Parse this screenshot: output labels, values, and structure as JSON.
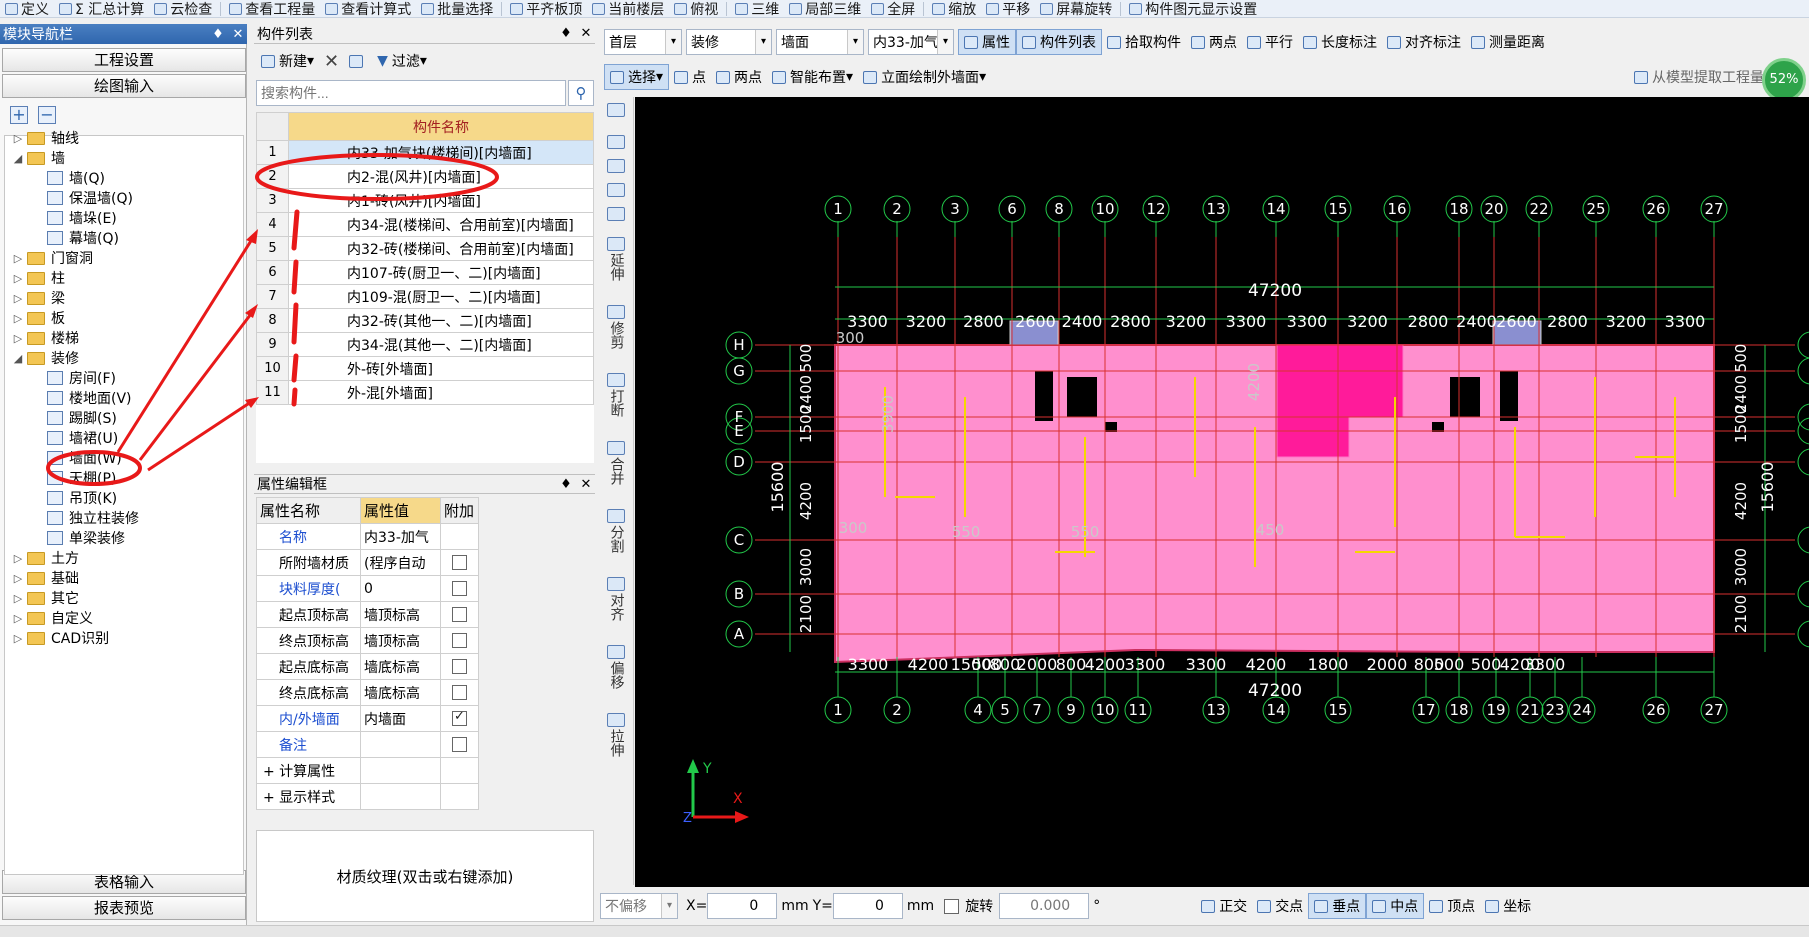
{
  "top_toolbar": {
    "items": [
      "定义",
      "Σ 汇总计算",
      "云检查",
      "查看工程量",
      "查看计算式",
      "批量选择",
      "平齐板顶",
      "当前楼层",
      "俯视",
      "三维",
      "局部三维",
      "全屏",
      "缩放",
      "平移",
      "屏幕旋转",
      "构件图元显示设置"
    ]
  },
  "nav": {
    "title": "模块导航栏",
    "pin": "♦",
    "close": "✕",
    "btn_project": "工程设置",
    "btn_draw": "绘图输入",
    "btn_table": "表格输入",
    "btn_report": "报表预览",
    "tree": [
      {
        "label": "轴线",
        "type": "folder",
        "exp": "▷"
      },
      {
        "label": "墙",
        "type": "folder",
        "exp": "◢"
      },
      {
        "label": "墙(Q)",
        "type": "leaf"
      },
      {
        "label": "保温墙(Q)",
        "type": "leaf"
      },
      {
        "label": "墙垛(E)",
        "type": "leaf"
      },
      {
        "label": "幕墙(Q)",
        "type": "leaf"
      },
      {
        "label": "门窗洞",
        "type": "folder",
        "exp": "▷"
      },
      {
        "label": "柱",
        "type": "folder",
        "exp": "▷"
      },
      {
        "label": "梁",
        "type": "folder",
        "exp": "▷"
      },
      {
        "label": "板",
        "type": "folder",
        "exp": "▷"
      },
      {
        "label": "楼梯",
        "type": "folder",
        "exp": "▷"
      },
      {
        "label": "装修",
        "type": "folder",
        "exp": "◢"
      },
      {
        "label": "房间(F)",
        "type": "leaf"
      },
      {
        "label": "楼地面(V)",
        "type": "leaf"
      },
      {
        "label": "踢脚(S)",
        "type": "leaf"
      },
      {
        "label": "墙裙(U)",
        "type": "leaf"
      },
      {
        "label": "墙面(W)",
        "type": "leaf"
      },
      {
        "label": "天棚(P)",
        "type": "leaf"
      },
      {
        "label": "吊顶(K)",
        "type": "leaf"
      },
      {
        "label": "独立柱装修",
        "type": "leaf"
      },
      {
        "label": "单梁装修",
        "type": "leaf"
      },
      {
        "label": "土方",
        "type": "folder",
        "exp": "▷"
      },
      {
        "label": "基础",
        "type": "folder",
        "exp": "▷"
      },
      {
        "label": "其它",
        "type": "folder",
        "exp": "▷"
      },
      {
        "label": "自定义",
        "type": "folder",
        "exp": "▷"
      },
      {
        "label": "CAD识别",
        "type": "folder",
        "exp": "▷"
      }
    ]
  },
  "component_list": {
    "title": "构件列表",
    "pin": "♦",
    "close": "✕",
    "new_label": "新建",
    "delete_label": "✕",
    "filter_label": "过滤",
    "search_placeholder": "搜索构件...",
    "column": "构件名称",
    "rows": [
      {
        "n": "1",
        "name": "内33-加气块(楼梯间)[内墙面]"
      },
      {
        "n": "2",
        "name": "内2-混(风井)[内墙面]"
      },
      {
        "n": "3",
        "name": "内1-砖(风井)[内墙面]"
      },
      {
        "n": "4",
        "name": "内34-混(楼梯间、合用前室)[内墙面]"
      },
      {
        "n": "5",
        "name": "内32-砖(楼梯间、合用前室)[内墙面]"
      },
      {
        "n": "6",
        "name": "内107-砖(厨卫一、二)[内墙面]"
      },
      {
        "n": "7",
        "name": "内109-混(厨卫一、二)[内墙面]"
      },
      {
        "n": "8",
        "name": "内32-砖(其他一、二)[内墙面]"
      },
      {
        "n": "9",
        "name": "内34-混(其他一、二)[内墙面]"
      },
      {
        "n": "10",
        "name": "外-砖[外墙面]"
      },
      {
        "n": "11",
        "name": "外-混[外墙面]"
      }
    ]
  },
  "props": {
    "title": "属性编辑框",
    "pin": "♦",
    "close": "✕",
    "col_name": "属性名称",
    "col_value": "属性值",
    "col_extra": "附加",
    "rows": [
      {
        "name": "名称",
        "value": "内33-加气",
        "blue": true,
        "cb": null
      },
      {
        "name": "所附墙材质",
        "value": "(程序自动",
        "blue": false,
        "cb": false
      },
      {
        "name": "块料厚度(",
        "value": "0",
        "blue": true,
        "cb": false
      },
      {
        "name": "起点顶标高",
        "value": "墙顶标高",
        "blue": false,
        "cb": false
      },
      {
        "name": "终点顶标高",
        "value": "墙顶标高",
        "blue": false,
        "cb": false
      },
      {
        "name": "起点底标高",
        "value": "墙底标高",
        "blue": false,
        "cb": false
      },
      {
        "name": "终点底标高",
        "value": "墙底标高",
        "blue": false,
        "cb": false
      },
      {
        "name": "内/外墙面",
        "value": "内墙面",
        "blue": true,
        "cb": true
      },
      {
        "name": "备注",
        "value": "",
        "blue": true,
        "cb": false
      },
      {
        "name": "+ 计算属性",
        "value": "",
        "blue": false,
        "cb": null
      },
      {
        "name": "+ 显示样式",
        "value": "",
        "blue": false,
        "cb": null
      }
    ],
    "texture": "材质纹理(双击或右键添加)"
  },
  "toolbar2": {
    "floor": "首层",
    "category": "装修",
    "type": "墙面",
    "component": "内33-加气",
    "btn_props": "属性",
    "btn_list": "构件列表",
    "btn_pick": "拾取构件",
    "btn_twopoint": "两点",
    "btn_parallel": "平行",
    "btn_length": "长度标注",
    "btn_align": "对齐标注",
    "btn_measure": "测量距离"
  },
  "toolbar3": {
    "select": "选择",
    "point": "点",
    "twopoint": "两点",
    "smart": "智能布置",
    "elevation": "立面绘制外墙面",
    "extract": "从模型提取工程量",
    "zoom_badge": "52%"
  },
  "vtools": [
    "延伸",
    "修剪",
    "打断",
    "合并",
    "分割",
    "对齐",
    "偏移",
    "拉伸"
  ],
  "drawing": {
    "top_axes": [
      "1",
      "2",
      "3",
      "6",
      "8",
      "10",
      "12",
      "13",
      "14",
      "15",
      "16",
      "18",
      "20",
      "22",
      "25",
      "26",
      "27"
    ],
    "bottom_axes": [
      "1",
      "2",
      "4",
      "5",
      "7",
      "9",
      "10",
      "11",
      "13",
      "14",
      "15",
      "17",
      "18",
      "19",
      "21",
      "23",
      "24",
      "26",
      "27"
    ],
    "row_axes": [
      "H",
      "G",
      "F",
      "E",
      "D",
      "C",
      "B",
      "A"
    ],
    "total_width": "47200",
    "top_dims": [
      "3300",
      "3200",
      "2800",
      "2600",
      "2400",
      "2800",
      "3200",
      "3300",
      "3300",
      "3200",
      "2800",
      "2400",
      "2600",
      "2800",
      "3200",
      "3300"
    ],
    "bottom_dims": [
      "3300",
      "4200",
      "1500",
      "500",
      "800",
      "2000",
      "800",
      "4200",
      "3300",
      "3300",
      "4200",
      "1800",
      "2000",
      "800",
      "500",
      "500",
      "4200",
      "3300"
    ],
    "left_dims": [
      "500",
      "2400",
      "1500",
      "4200",
      "3000",
      "2100"
    ],
    "total_height": "15600",
    "labels": [
      "300",
      "3900",
      "300",
      "550",
      "550",
      "450",
      "4200"
    ]
  },
  "status": {
    "offset": "不偏移",
    "x_label": "X=",
    "x_val": "0",
    "unit": "mm",
    "y_label": "Y=",
    "y_val": "0",
    "rotate": "旋转",
    "rot_val": "0.000",
    "deg": "°",
    "snaps": [
      "正交",
      "交点",
      "垂点",
      "中点",
      "顶点",
      "坐标"
    ]
  },
  "colors": {
    "accent": "#2f66ae",
    "header_gold": "#f6d98a",
    "wall_pink": "#ff8fce",
    "annotation_red": "#e81919"
  }
}
